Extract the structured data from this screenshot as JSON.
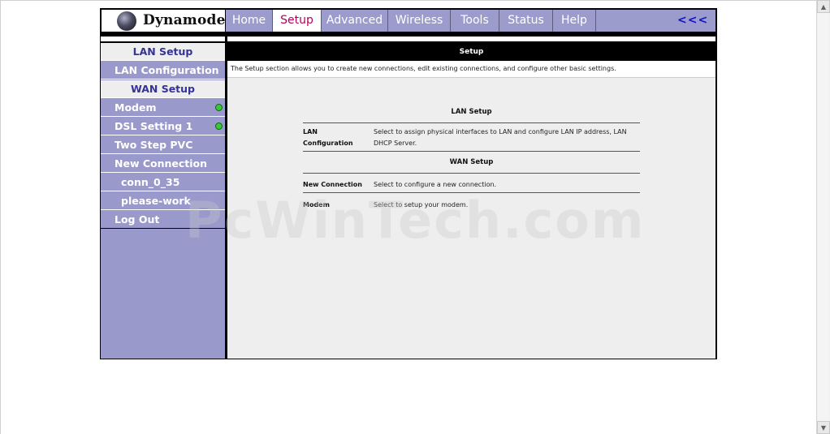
{
  "logo": {
    "text": "Dynamode"
  },
  "nav": {
    "tabs": [
      {
        "label": "Home"
      },
      {
        "label": "Setup",
        "active": true
      },
      {
        "label": "Advanced"
      },
      {
        "label": "Wireless"
      },
      {
        "label": "Tools"
      },
      {
        "label": "Status"
      },
      {
        "label": "Help"
      }
    ],
    "back_label": "<<<"
  },
  "sidebar": {
    "items": [
      {
        "label": "LAN Setup",
        "type": "heading"
      },
      {
        "label": "LAN Configuration",
        "type": "link"
      },
      {
        "label": "WAN Setup",
        "type": "heading"
      },
      {
        "label": "Modem",
        "type": "link",
        "status": "green"
      },
      {
        "label": "DSL Setting 1",
        "type": "link",
        "status": "green"
      },
      {
        "label": "Two Step PVC",
        "type": "link"
      },
      {
        "label": "New Connection",
        "type": "link"
      },
      {
        "label": "conn_0_35",
        "type": "sublink"
      },
      {
        "label": "please-work",
        "type": "sublink"
      },
      {
        "label": "Log Out",
        "type": "link"
      }
    ]
  },
  "content": {
    "title": "Setup",
    "intro": "The Setup section allows you to create new connections, edit existing connections, and configure other basic settings.",
    "lan_heading": "LAN Setup",
    "lan_rows": [
      {
        "key": "LAN Configuration",
        "value": "Select to assign physical interfaces to LAN and configure LAN IP address, LAN DHCP Server."
      }
    ],
    "wan_heading": "WAN Setup",
    "wan_rows": [
      {
        "key": "New Connection",
        "value": "Select to configure a new connection."
      },
      {
        "key": "Modem",
        "value": "Select to setup your modem."
      }
    ]
  },
  "watermark": "PcWinTech.com",
  "colors": {
    "nav_bg": "#9b9ccc",
    "sidebar_bg": "#9999cc",
    "active_tab_text": "#b5005d",
    "status_green": "#33cc33",
    "back_link": "#1010d0"
  }
}
